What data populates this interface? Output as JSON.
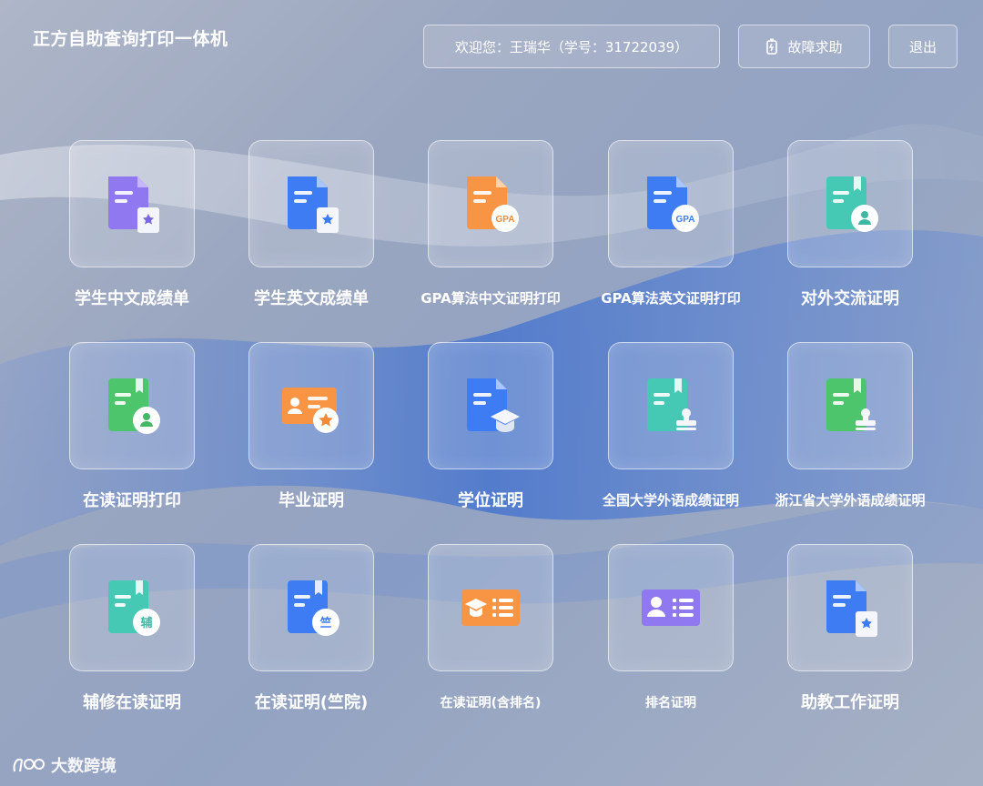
{
  "header": {
    "app_title": "正方自助查询打印一体机",
    "welcome_text": "欢迎您：王瑞华（学号：31722039）",
    "help_label": "故障求助",
    "logout_label": "退出"
  },
  "tiles": [
    {
      "label": "学生中文成绩单",
      "icon": "transcript-cn-icon"
    },
    {
      "label": "学生英文成绩单",
      "icon": "transcript-en-icon"
    },
    {
      "label": "GPA算法中文证明打印",
      "icon": "gpa-cn-icon",
      "icon_text": "GPA"
    },
    {
      "label": "GPA算法英文证明打印",
      "icon": "gpa-en-icon",
      "icon_text": "GPA"
    },
    {
      "label": "对外交流证明",
      "icon": "exchange-cert-icon"
    },
    {
      "label": "在读证明打印",
      "icon": "enrollment-cert-icon"
    },
    {
      "label": "毕业证明",
      "icon": "graduation-card-icon"
    },
    {
      "label": "学位证明",
      "icon": "degree-cert-icon"
    },
    {
      "label": "全国大学外语成绩证明",
      "icon": "national-english-cert-icon"
    },
    {
      "label": "浙江省大学外语成绩证明",
      "icon": "zhejiang-english-cert-icon"
    },
    {
      "label": "辅修在读证明",
      "icon": "minor-enrollment-icon",
      "icon_text": "辅"
    },
    {
      "label": "在读证明(竺院)",
      "icon": "chu-college-enrollment-icon",
      "icon_text": "竺"
    },
    {
      "label": "在读证明(含排名)",
      "icon": "ranked-enrollment-icon"
    },
    {
      "label": "排名证明",
      "icon": "ranking-cert-icon"
    },
    {
      "label": "助教工作证明",
      "icon": "ta-work-cert-icon"
    }
  ],
  "watermark": {
    "text": "大数跨境"
  },
  "colors": {
    "purple": "#8f78f0",
    "blue": "#3d7cf3",
    "orange": "#f79545",
    "teal": "#45c9b4",
    "green": "#4cc56c"
  }
}
